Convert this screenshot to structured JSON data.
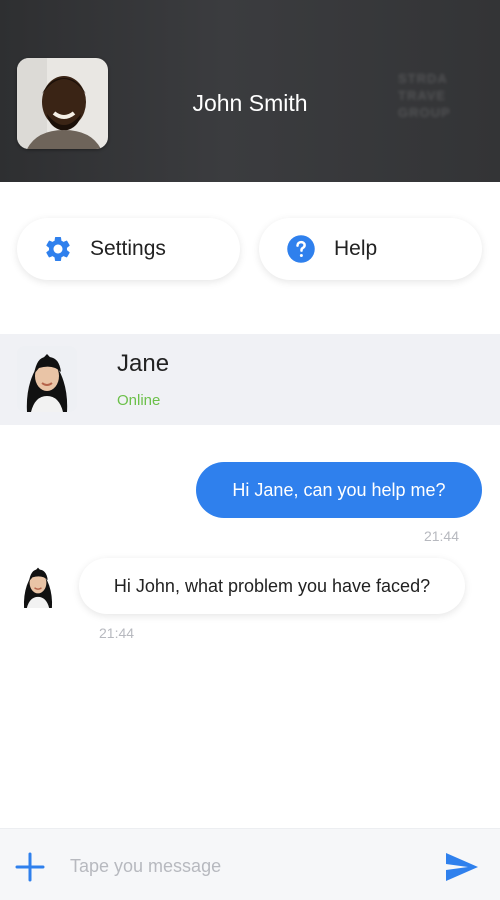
{
  "header": {
    "user_name": "John Smith",
    "avatar_icon": "user-avatar-photo",
    "logo_text": [
      "STRDA",
      "TRAVE",
      "GROUP"
    ]
  },
  "actions": {
    "settings_label": "Settings",
    "settings_icon": "gear-icon",
    "help_label": "Help",
    "help_icon": "question-circle-icon"
  },
  "contact": {
    "name": "Jane",
    "status": "Online",
    "status_color": "#6cc04a"
  },
  "messages": [
    {
      "direction": "outgoing",
      "text": "Hi Jane, can you help me?",
      "time": "21:44"
    },
    {
      "direction": "incoming",
      "text": "Hi John, what problem you have faced?",
      "time": "21:44"
    }
  ],
  "composer": {
    "placeholder": "Tape you message",
    "value": "",
    "attach_icon": "plus-icon",
    "send_icon": "send-icon"
  },
  "colors": {
    "accent": "#2f80ed",
    "header_bg": "#333436",
    "contact_bg": "#f0f1f5"
  }
}
